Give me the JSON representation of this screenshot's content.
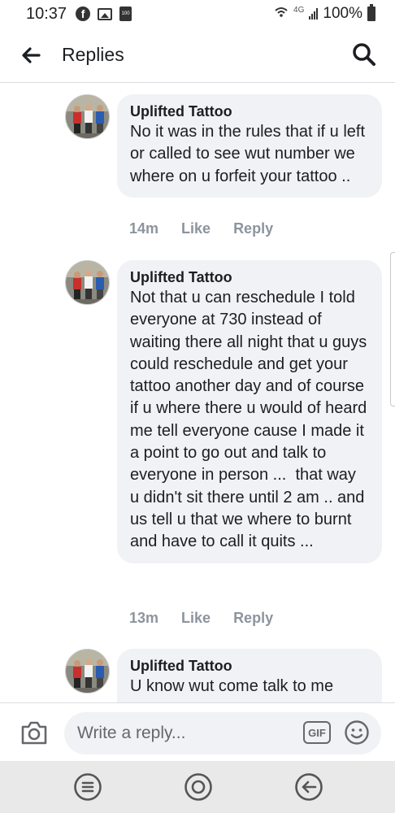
{
  "status_bar": {
    "time": "10:37",
    "network": "4G",
    "battery": "100%",
    "notification_badge": "100"
  },
  "header": {
    "title": "Replies",
    "back_icon": "arrow-left-icon",
    "search_icon": "search-icon"
  },
  "comments": [
    {
      "author": "Uplifted Tattoo",
      "text": "No it was in the rules that if u left or called to see wut number we where on u forfeit your tattoo ..",
      "time": "14m",
      "like_label": "Like",
      "reply_label": "Reply"
    },
    {
      "author": "Uplifted Tattoo",
      "text": "Not that u can reschedule I told everyone at 730 instead of waiting there all night that u guys could reschedule and get your tattoo another day and of course if u where there u would of heard me tell everyone cause I made it a point to go out and talk to everyone in person ...  that way u didn't sit there until 2 am .. and us tell u that we where to burnt and have to call it quits ...",
      "time": "13m",
      "like_label": "Like",
      "reply_label": "Reply"
    },
    {
      "author": "Uplifted Tattoo",
      "text": "U know wut come talk to me",
      "time": "",
      "like_label": "",
      "reply_label": ""
    }
  ],
  "reply_bar": {
    "placeholder": "Write a reply...",
    "gif_label": "GIF",
    "camera_icon": "camera-icon",
    "emoji_icon": "smiley-icon"
  },
  "nav_bar": {
    "recents_icon": "recent-apps-icon",
    "home_icon": "home-icon",
    "back_icon": "back-icon"
  },
  "colors": {
    "bubble": "#f0f2f5",
    "meta_text": "#8d949e",
    "nav_bg": "#e9e9e9"
  }
}
